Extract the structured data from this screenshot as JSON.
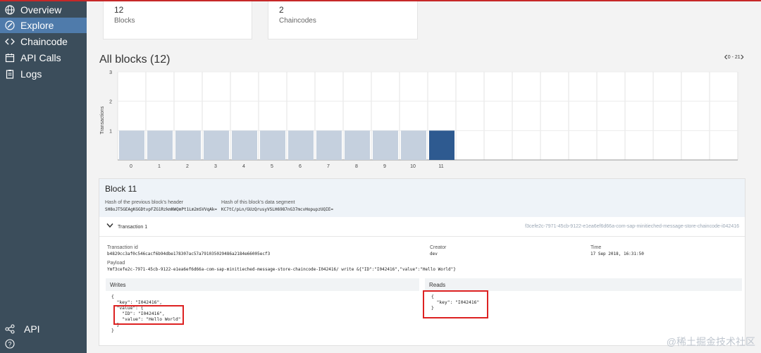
{
  "sidebar": {
    "items": [
      {
        "label": "Overview",
        "icon": "globe-icon",
        "active": false
      },
      {
        "label": "Explore",
        "icon": "compass-icon",
        "active": true
      },
      {
        "label": "Chaincode",
        "icon": "code-icon",
        "active": false
      },
      {
        "label": "API Calls",
        "icon": "calendar-icon",
        "active": false
      },
      {
        "label": "Logs",
        "icon": "clipboard-icon",
        "active": false
      }
    ],
    "bottom": {
      "api_label": "API",
      "api_icon": "share-icon",
      "help_icon": "help-icon"
    }
  },
  "stats": [
    {
      "value": "12",
      "label": "Blocks"
    },
    {
      "value": "2",
      "label": "Chaincodes"
    }
  ],
  "blocks_section": {
    "title": "All blocks (12)",
    "pager": "0 - 21"
  },
  "chart_data": {
    "type": "bar",
    "ylabel": "Transactions",
    "ylim": [
      0,
      3
    ],
    "yticks": [
      1,
      2,
      3
    ],
    "categories": [
      "0",
      "1",
      "2",
      "3",
      "4",
      "5",
      "6",
      "7",
      "8",
      "9",
      "10",
      "11"
    ],
    "values": [
      1,
      1,
      1,
      1,
      1,
      1,
      1,
      1,
      1,
      1,
      1,
      1
    ],
    "highlighted_index": 11,
    "slots": 22,
    "grid": true,
    "colors": {
      "bar": "#c5d0de",
      "highlight": "#2e5a90"
    }
  },
  "block_detail": {
    "title": "Block 11",
    "prev_hash_label": "Hash of the previous block's header",
    "prev_hash_value": "SH8oJT5GEAgKGGDtvpFZG1RzkmNWQmPt1Lm2mSVVqAk=",
    "data_hash_label": "Hash of this block's data segment",
    "data_hash_value": "KC7tC/pLn/GUzQrusyVSLH6987nG37mcvHopupzUQIE=",
    "transaction": {
      "label": "Transaction 1",
      "right_text": "f3cefe2c-7971-45cb-9122-e1ea6ef6d66a-com-sap-minitieched-message-store-chaincode-i042416",
      "id_label": "Transaction id",
      "id_value": "b4829cc3af0c546cacf6b94dbe178307ac57a791035029486a2184e66005ecf3",
      "creator_label": "Creator",
      "creator_value": "dev",
      "time_label": "Time",
      "time_value": "17 Sep 2018, 16:31:50",
      "payload_label": "Payload",
      "payload_value": "Ymf3cefe2c-7971-45cb-9122-e1ea6ef6d66a-com-sap-minitieched-message-store-chaincode-I042416/ write &{\"ID\":\"I042416\",\"value\":\"Hello World\"}"
    },
    "writes": {
      "title": "Writes",
      "lines": [
        "{",
        "  \"key\": \"I042416\",",
        "  \"value\": {",
        "    \"ID\": \"I042416\",",
        "    \"value\": \"Hello World\"",
        "  }",
        "}"
      ]
    },
    "reads": {
      "title": "Reads",
      "lines": [
        "{",
        "  \"key\": \"I042416\"",
        "}"
      ]
    }
  },
  "watermark": "@稀土掘金技术社区"
}
